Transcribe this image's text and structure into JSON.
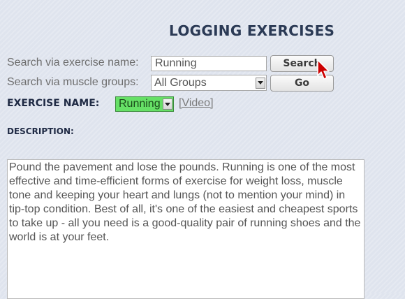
{
  "header": {
    "title": "LOGGING EXERCISES"
  },
  "search": {
    "name_label": "Search via exercise name:",
    "name_value": "Running",
    "search_button": "Search",
    "muscle_label": "Search via muscle groups:",
    "muscle_selected": "All Groups",
    "go_button": "Go"
  },
  "exercise": {
    "label": "EXERCISE NAME:",
    "selected": "Running",
    "video_link": "[Video]"
  },
  "description": {
    "label": "DESCRIPTION:",
    "text": "Pound the pavement and lose the pounds. Running is one of the most effective and time-efficient forms of exercise for weight loss, muscle tone and keeping your heart and lungs (not to mention your mind) in tip-top condition. Best of all, it's one of the easiest and cheapest sports to take up - all you need is a good-quality pair of running shoes and the world is at your feet."
  },
  "colors": {
    "title": "#2b3a55",
    "exercise_select_bg": "#66e066",
    "cursor_accent": "#cc0000"
  },
  "icons": {
    "dropdown": "chevron-down-icon",
    "cursor": "mouse-pointer-icon"
  }
}
